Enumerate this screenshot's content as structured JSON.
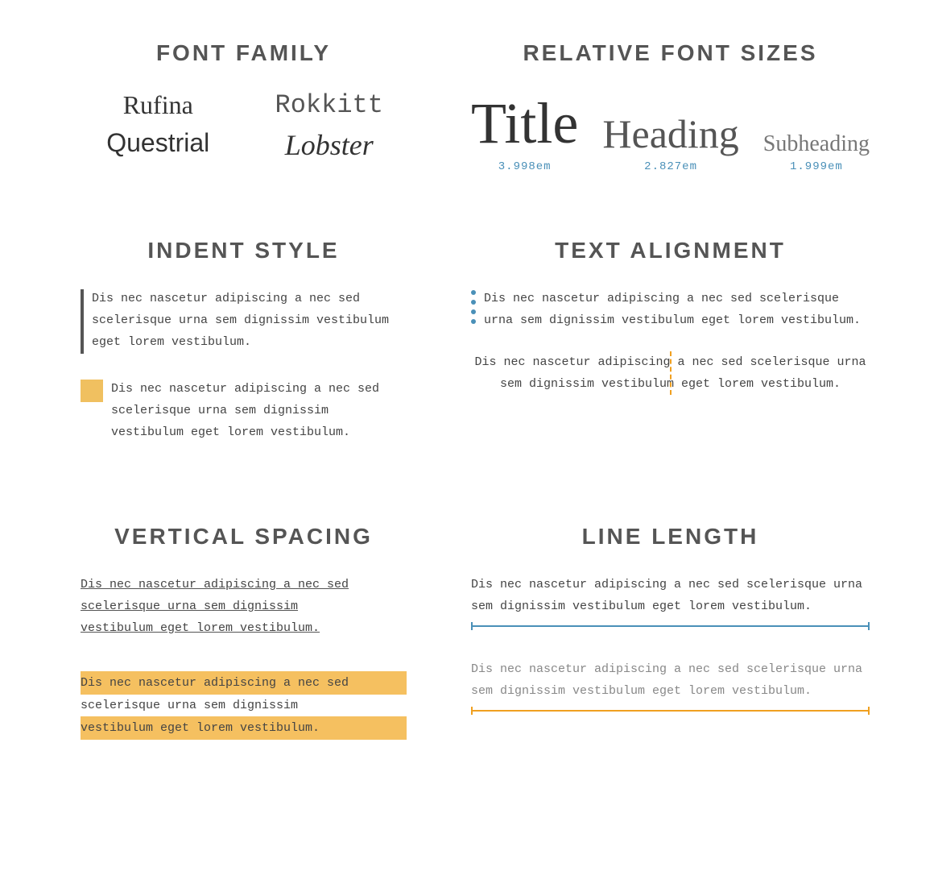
{
  "fontFamily": {
    "title": "FONT FAMiLy",
    "fonts": [
      "Rufina",
      "Rokkitt",
      "Questrial",
      "Lobster"
    ]
  },
  "relativeFontSizes": {
    "title": "RELATIVE FONT SIZES",
    "items": [
      {
        "label": "Title",
        "size": "3.998em"
      },
      {
        "label": "Heading",
        "size": "2.827em"
      },
      {
        "label": "Subheading",
        "size": "1.999em"
      }
    ]
  },
  "indentStyle": {
    "title": "INDENT STYLE",
    "text1": "Dis nec nascetur adipiscing a nec sed scelerisque urna sem dignissim vestibulum eget lorem vestibulum.",
    "text2": "Dis nec nascetur adipiscing a nec sed scelerisque urna sem dignissim vestibulum eget lorem vestibulum."
  },
  "textAlignment": {
    "title": "TEXT ALIGNMENT",
    "text1": "Dis nec nascetur adipiscing a nec sed scelerisque urna sem dignissim vestibulum eget lorem vestibulum.",
    "text2": "Dis nec nascetur adipiscing a nec sed scelerisque urna sem dignissim vestibulum eget lorem vestibulum."
  },
  "verticalSpacing": {
    "title": "VERTICAL SPACING",
    "text1": "Dis nec nascetur adipiscing a nec sed scelerisque urna sem dignissim vestibulum eget lorem vestibulum.",
    "text2line1": "Dis nec nascetur adipiscing a nec sed",
    "text2line2": "scelerisque urna sem dignissim",
    "text2line3": "vestibulum eget lorem vestibulum."
  },
  "lineLength": {
    "title": "LINE LENGTH",
    "text1": "Dis nec nascetur adipiscing a nec sed scelerisque urna sem dignissim vestibulum eget lorem vestibulum.",
    "text2": "Dis nec nascetur adipiscing a nec sed scelerisque urna sem dignissim vestibulum eget lorem vestibulum.",
    "accentColor": "#4a90b8",
    "accentColorOrange": "#f0a020"
  }
}
